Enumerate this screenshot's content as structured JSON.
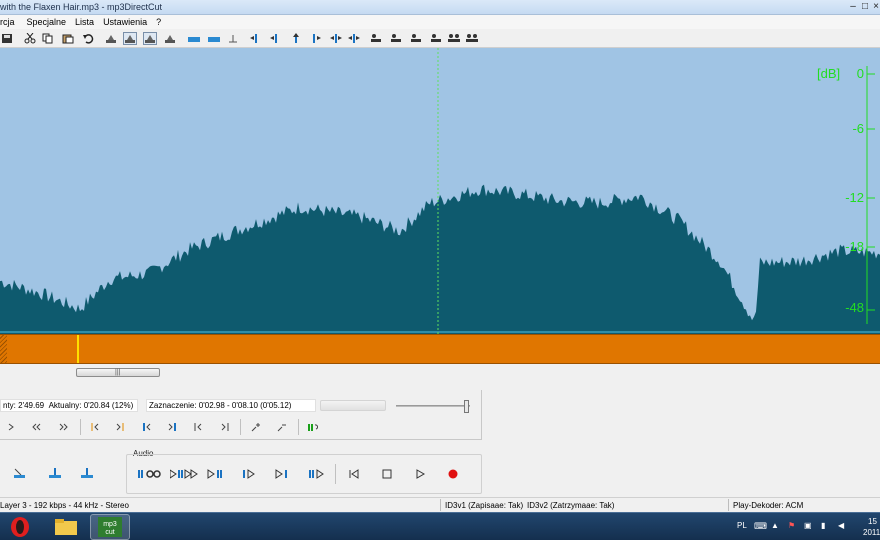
{
  "window": {
    "title": "with the Flaxen Hair.mp3 - mp3DirectCut",
    "controls": [
      "minimize-icon",
      "maximize-icon",
      "close-icon"
    ]
  },
  "menu": {
    "items": [
      "rcja",
      "Specjalne",
      "Lista",
      "Ustawienia",
      "?"
    ]
  },
  "toolbar": {
    "icons": [
      "save-icon",
      "cut-icon",
      "copy-icon",
      "paste-icon",
      "undo-icon",
      "vol-icon",
      "vol-icon",
      "vol-icon",
      "vol-icon",
      "wave-icon",
      "wave-icon",
      "cue-icon",
      "marker-icon",
      "marker-icon",
      "marker-icon",
      "marker-icon",
      "marker-icon",
      "person-icon",
      "person-icon",
      "person-icon",
      "person-icon",
      "person-icon",
      "person-icon"
    ]
  },
  "db_scale": {
    "unit": "[dB]",
    "ticks": [
      "0",
      "-6",
      "-12",
      "-18",
      "-48"
    ]
  },
  "colors": {
    "waveform_bg": "#a0c4e4",
    "waveform": "#0e5a6e",
    "db_text": "#22dd22",
    "timeline": "#e07600",
    "cursor": "#ffe000"
  },
  "info": {
    "total": "nty: 2'49.69",
    "current": "Aktualny: 0'20.84  (12%)",
    "selection": "Zaznaczenie: 0'02.98 - 0'08.10 (0'05.12)",
    "position_fraction": 0.12
  },
  "audio": {
    "label": "Audio"
  },
  "status": {
    "format": "Layer 3 - 192 kbps - 44 kHz - Stereo",
    "id3v1": "ID3v1 (Zapisaae: Tak)",
    "id3v2": "ID3v2 (Zatrzymaae: Tak)",
    "decoder": "Play-Dekoder: ACM"
  },
  "taskbar": {
    "lang": "PL",
    "clock_time": "15",
    "clock_date": "2011-",
    "apps": [
      "opera-icon",
      "folder-icon",
      "mp3directcut-icon"
    ]
  }
}
